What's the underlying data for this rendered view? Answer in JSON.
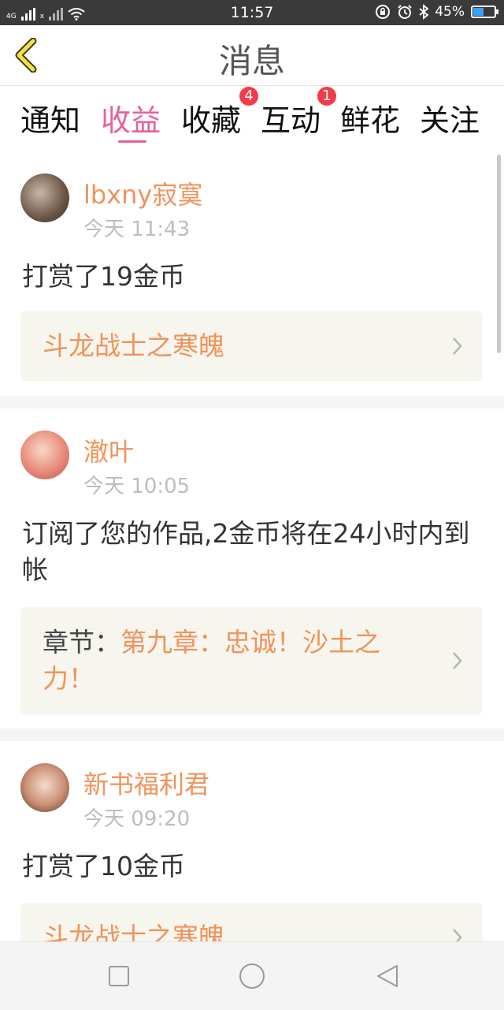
{
  "status_bar": {
    "network_1": "4G",
    "network_2": "x",
    "time": "11:57",
    "battery": "45%",
    "battery_level": 0.45,
    "icons": [
      "signal-icon",
      "wifi-icon",
      "lock-rotation-icon",
      "alarm-icon",
      "bluetooth-icon",
      "battery-icon"
    ]
  },
  "header": {
    "title": "消息",
    "back_icon": "chevron-left-icon"
  },
  "tabs": [
    {
      "label": "通知",
      "active": false
    },
    {
      "label": "收益",
      "active": true
    },
    {
      "label": "收藏",
      "active": false,
      "badge": "4"
    },
    {
      "label": "互动",
      "active": false,
      "badge": "1"
    },
    {
      "label": "鲜花",
      "active": false
    },
    {
      "label": "关注",
      "active": false
    }
  ],
  "colors": {
    "accent": "#e8609a",
    "name": "#f0935a",
    "badge": "#f43b4a"
  },
  "messages": [
    {
      "user": "lbxny寂寞",
      "time": "今天 11:43",
      "action": "打赏了19金币",
      "box_prefix": "",
      "box_text": "斗龙战士之寒魄"
    },
    {
      "user": "澈叶",
      "time": "今天 10:05",
      "action": "订阅了您的作品,2金币将在24小时内到帐",
      "box_prefix": "章节：",
      "box_text": "第九章：忠诚！沙土之力！"
    },
    {
      "user": "新书福利君",
      "time": "今天 09:20",
      "action": "打赏了10金币",
      "box_prefix": "",
      "box_text": "斗龙战士之寒魄"
    }
  ],
  "nav": {
    "icons": [
      "recent-apps-icon",
      "home-icon",
      "back-icon"
    ]
  }
}
